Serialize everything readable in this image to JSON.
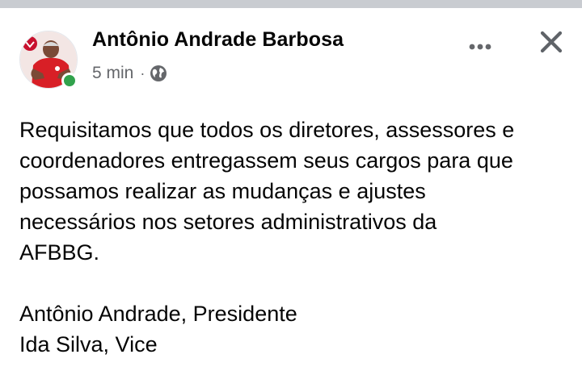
{
  "post": {
    "author": "Antônio Andrade Barbosa",
    "timestamp": "5 min",
    "separator": "·",
    "privacy_icon": "globe-icon",
    "more_icon": "more-options-icon",
    "close_icon": "close-icon",
    "online_status_color": "#31a24c",
    "body": {
      "paragraph_1": "Requisitamos que todos os diretores, assessores e\ncoordenadores entregassem seus cargos para que\npossamos realizar as mudanças e ajustes\nnecessários nos setores administrativos da\nAFBBG.",
      "signature_line_1": "Antônio Andrade, Presidente",
      "signature_line_2": "Ida Silva, Vice"
    }
  }
}
